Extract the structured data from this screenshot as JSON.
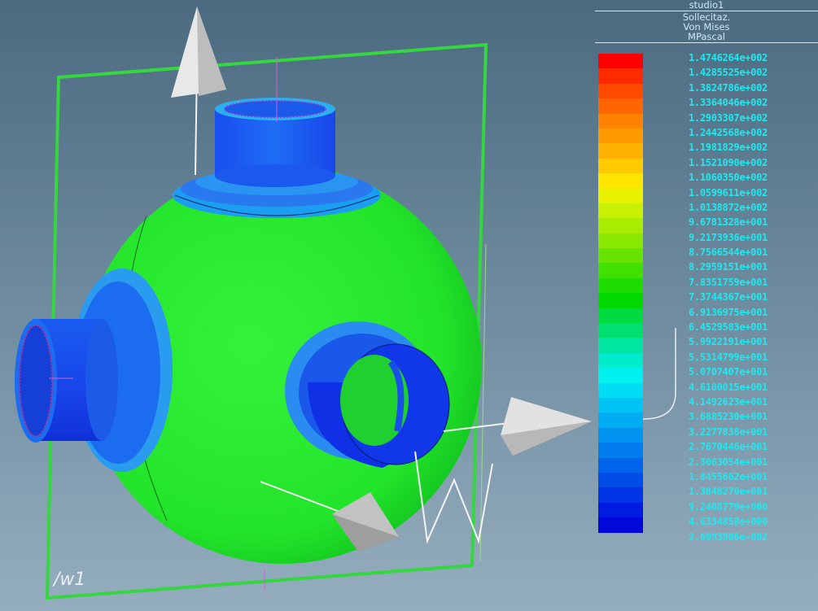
{
  "legend": {
    "study_name": "studio1",
    "quantity": "Sollecitaz.",
    "measure": "Von Mises",
    "unit": "MPascal",
    "colors": [
      "#ff0000",
      "#ff2a00",
      "#ff4a00",
      "#ff6600",
      "#ff8200",
      "#ff9a00",
      "#ffb200",
      "#ffcb00",
      "#ffe600",
      "#e8f200",
      "#c8f000",
      "#a8ec00",
      "#88e800",
      "#66e400",
      "#40e000",
      "#1cdc00",
      "#00d800",
      "#00dc40",
      "#00e070",
      "#00e6a0",
      "#00ecca",
      "#00f0ee",
      "#00dcf4",
      "#00c4f4",
      "#00acf2",
      "#0094f0",
      "#007cee",
      "#0064ec",
      "#004ce8",
      "#0034e4",
      "#001ce0",
      "#0008da"
    ],
    "values": [
      "1.4746264e+002",
      "1.4285525e+002",
      "1.3824786e+002",
      "1.3364046e+002",
      "1.2903307e+002",
      "1.2442568e+002",
      "1.1981829e+002",
      "1.1521090e+002",
      "1.1060350e+002",
      "1.0599611e+002",
      "1.0138872e+002",
      "9.6781328e+001",
      "9.2173936e+001",
      "8.7566544e+001",
      "8.2959151e+001",
      "7.8351759e+001",
      "7.3744367e+001",
      "6.9136975e+001",
      "6.4529583e+001",
      "5.9922191e+001",
      "5.5314799e+001",
      "5.0707407e+001",
      "4.6100015e+001",
      "4.1492623e+001",
      "3.6885230e+001",
      "3.2277838e+001",
      "2.7670446e+001",
      "2.3063054e+001",
      "1.8455662e+001",
      "1.3848270e+001",
      "9.2408779e+000",
      "4.6334858e+000",
      "2.6093906e-002"
    ]
  },
  "workplane": {
    "label": "/w1"
  },
  "viewport": {
    "sphere_color": "#22ec2a",
    "nozzle_color": "#1040f0",
    "frame_color": "#35d640",
    "glyphs": [
      "arrow-cone-icon",
      "triad-w-icon"
    ]
  }
}
